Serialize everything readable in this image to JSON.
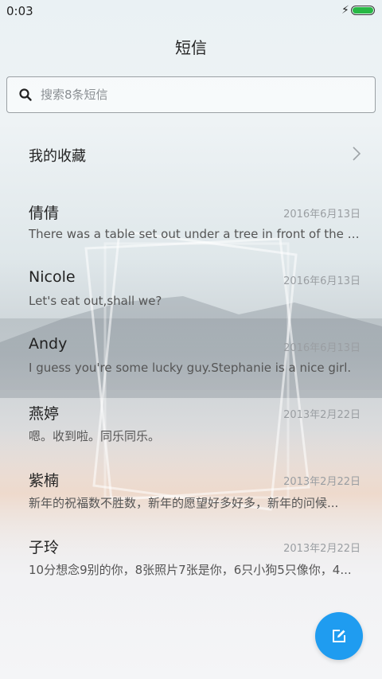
{
  "status_bar": {
    "time": "0:03",
    "charging_icon": "bolt-icon",
    "battery_level": 1.0,
    "battery_color": "#28b845"
  },
  "header": {
    "title": "短信"
  },
  "search": {
    "placeholder": "搜索8条短信",
    "value": "",
    "icon": "search-icon"
  },
  "favorites": {
    "label": "我的收藏",
    "icon": "chevron-right-icon"
  },
  "conversations": [
    {
      "name": "倩倩",
      "date": "2016年6月13日",
      "preview": "There was a table set out under a tree in front of the ho..."
    },
    {
      "name": "Nicole",
      "date": "2016年6月13日",
      "preview": "Let's eat out,shall we?"
    },
    {
      "name": "Andy",
      "date": "2016年6月13日",
      "preview": "I guess you're some lucky guy.Stephanie is a nice girl."
    },
    {
      "name": "燕婷",
      "date": "2013年2月22日",
      "preview": "嗯。收到啦。同乐同乐。"
    },
    {
      "name": "紫楠",
      "date": "2013年2月22日",
      "preview": "新年的祝福数不胜数，新年的愿望好多好多，新年的问候..."
    },
    {
      "name": "子玲",
      "date": "2013年2月22日",
      "preview": "10分想念9别的你，8张照片7张是你，6只小狗5只像你，4..."
    }
  ],
  "compose_button": {
    "icon": "compose-icon",
    "color": "#1f9cf0"
  }
}
